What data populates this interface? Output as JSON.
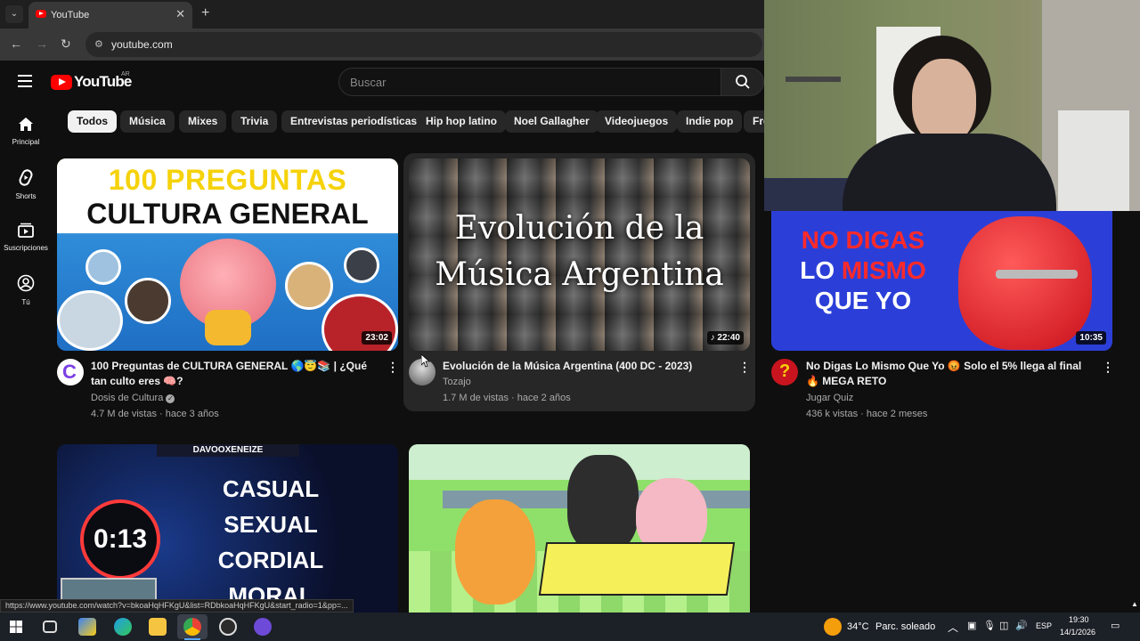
{
  "browser": {
    "tab_title": "YouTube",
    "url": "youtube.com",
    "status_url": "https://www.youtube.com/watch?v=bkoaHqHFKgU&list=RDbkoaHqHFKgU&start_radio=1&pp=..."
  },
  "youtube": {
    "logo_text": "YouTube",
    "country": "AR",
    "search_placeholder": "Buscar",
    "sidebar": [
      {
        "label": "Principal",
        "icon": "home-icon"
      },
      {
        "label": "Shorts",
        "icon": "shorts-icon"
      },
      {
        "label": "Suscripciones",
        "icon": "subscriptions-icon"
      },
      {
        "label": "Tú",
        "icon": "you-icon"
      }
    ],
    "chips": [
      "Todos",
      "Música",
      "Mixes",
      "Trivia",
      "Entrevistas periodísticas",
      "Hip hop latino",
      "Noel Gallagher",
      "Videojuegos",
      "Indie pop",
      "Fre"
    ],
    "videos": [
      {
        "thumb_line1": "100 PREGUNTAS",
        "thumb_line2": "CULTURA GENERAL",
        "duration": "23:02",
        "title": "100 Preguntas de CULTURA GENERAL 🌎😇📚 | ¿Qué tan culto eres 🧠?",
        "channel": "Dosis de Cultura",
        "stats": "4.7 M de vistas · hace 3 años",
        "avatar_letter": "C",
        "verified": true
      },
      {
        "thumb_line1": "Evolución de la",
        "thumb_line2": "Música Argentina",
        "duration": "22:40",
        "title": "Evolución de la Música Argentina (400 DC - 2023)",
        "channel": "Tozajo",
        "stats": "1.7 M de vistas · hace 2 años"
      },
      {
        "thumb_line1": "NO DIGAS",
        "thumb_line2a": "LO ",
        "thumb_line2b": "MISMO",
        "thumb_line3": "QUE YO",
        "duration": "10:35",
        "title": "No Digas Lo Mismo Que Yo 😡 Solo el 5% llega al final 🔥 MEGA RETO",
        "channel": "Jugar Quiz",
        "stats": "436 k vistas · hace 2 meses",
        "avatar_letter": "?"
      },
      {
        "thumb_brand": "DAVOOXENEIZE",
        "timer": "0:13",
        "words": [
          "CASUAL",
          "SEXUAL",
          "CORDIAL",
          "MORAL"
        ]
      },
      {
        "thumb_desc": ""
      }
    ]
  },
  "taskbar": {
    "weather_temp": "34°C",
    "weather_desc": "Parc. soleado",
    "lang": "ESP",
    "time": "19:30",
    "date": "14/1/2026"
  }
}
